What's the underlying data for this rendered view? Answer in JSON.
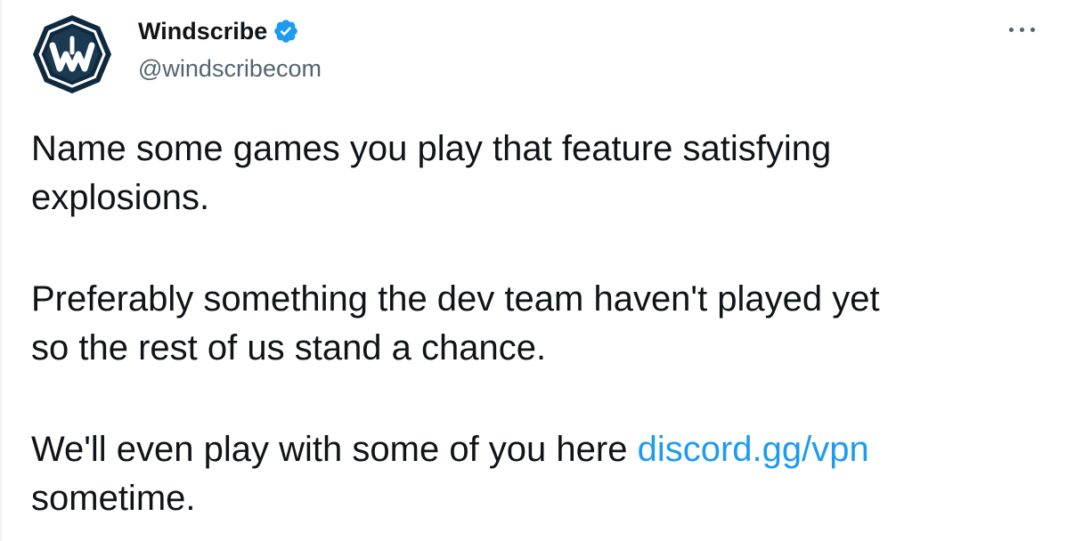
{
  "author": {
    "display_name": "Windscribe",
    "handle": "@windscribecom",
    "verified": true,
    "avatar_letter": "W"
  },
  "tweet": {
    "paragraphs": [
      {
        "lines": [
          "Name some games you play that feature satisfying",
          "explosions."
        ]
      },
      {
        "lines": [
          "Preferably something the dev team haven't played yet",
          "so the rest of us stand a chance."
        ]
      },
      {
        "line1_prefix": "We'll even play with some of you here ",
        "link_text": "discord.gg/vpn",
        "line2": "sometime."
      }
    ]
  },
  "icons": {
    "verified": "verified-badge-icon",
    "more": "more-options-icon"
  },
  "colors": {
    "text": "#0f1419",
    "secondary": "#536471",
    "link": "#1d9bf0",
    "avatar_bg": "#1b3a52",
    "avatar_ring": "#ffffff"
  }
}
